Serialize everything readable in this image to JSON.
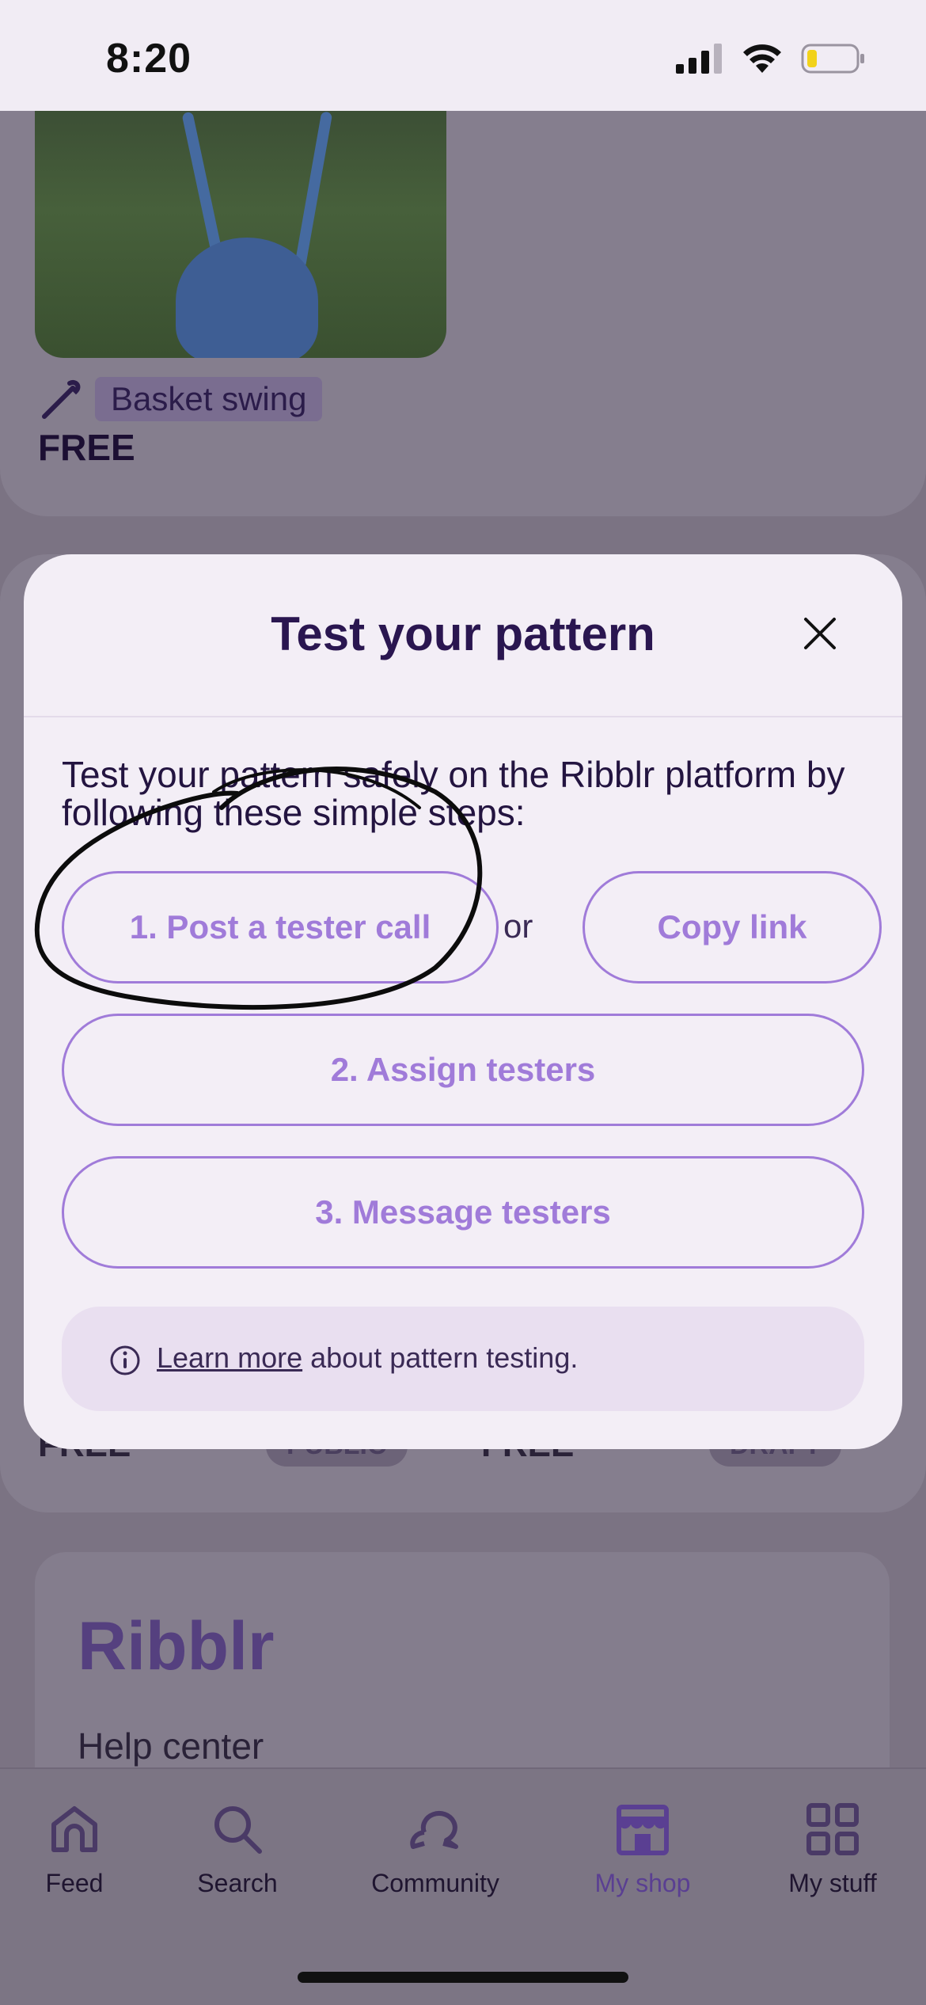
{
  "status_bar": {
    "time": "8:20"
  },
  "background": {
    "item_tag": "Basket swing",
    "item_price": "FREE",
    "peek_price_left": "FREE",
    "peek_badge_left": "PUBLIC",
    "peek_price_right": "FREE",
    "peek_badge_right": "DRAFT",
    "brand": "Ribblr",
    "help_center": "Help center"
  },
  "modal": {
    "title": "Test your pattern",
    "description": "Test your pattern safely on the Ribblr platform by following these simple steps:",
    "step1_label": "1. Post a tester call",
    "or_label": "or",
    "copy_link_label": "Copy link",
    "step2_label": "2. Assign testers",
    "step3_label": "3. Message testers",
    "info_link": "Learn more",
    "info_text": " about pattern testing."
  },
  "tab_bar": {
    "items": [
      {
        "label": "Feed",
        "icon": "home-icon"
      },
      {
        "label": "Search",
        "icon": "search-icon"
      },
      {
        "label": "Community",
        "icon": "chat-icon"
      },
      {
        "label": "My shop",
        "icon": "shop-icon",
        "active": true
      },
      {
        "label": "My stuff",
        "icon": "grid-icon"
      }
    ]
  },
  "colors": {
    "accent": "#a07bd9",
    "title": "#2a1650",
    "modal_bg": "#f3eef6",
    "overlay": "#7b7383",
    "info_bg": "#e9dff0"
  }
}
